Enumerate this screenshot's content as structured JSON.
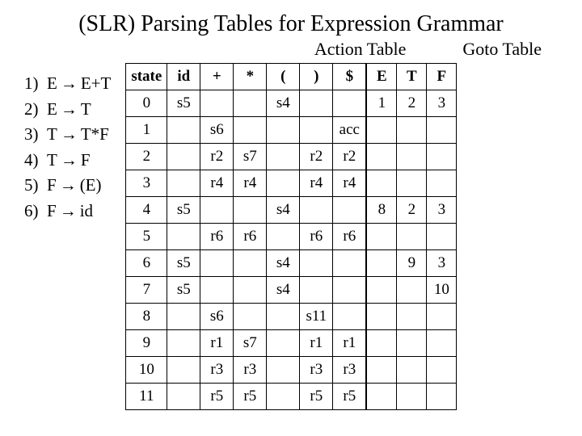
{
  "title": "(SLR) Parsing Tables for Expression Grammar",
  "action_title": "Action Table",
  "goto_title": "Goto Table",
  "grammar": [
    {
      "n": "1)",
      "lhs": "E",
      "rhs": "E+T"
    },
    {
      "n": "2)",
      "lhs": "E",
      "rhs": "T"
    },
    {
      "n": "3)",
      "lhs": "T",
      "rhs": "T*F"
    },
    {
      "n": "4)",
      "lhs": "T",
      "rhs": "F"
    },
    {
      "n": "5)",
      "lhs": "F",
      "rhs": "(E)"
    },
    {
      "n": "6)",
      "lhs": "F",
      "rhs": "id"
    }
  ],
  "arrow": "→",
  "headers": {
    "state": "state",
    "action": [
      "id",
      "+",
      "*",
      "(",
      ")",
      "$"
    ],
    "goto": [
      "E",
      "T",
      "F"
    ]
  },
  "chart_data": {
    "type": "table",
    "title": "SLR Parsing Table",
    "rows": [
      {
        "state": "0",
        "id": "s5",
        "plus": "",
        "star": "",
        "lpar": "s4",
        "rpar": "",
        "dollar": "",
        "E": "1",
        "T": "2",
        "F": "3"
      },
      {
        "state": "1",
        "id": "",
        "plus": "s6",
        "star": "",
        "lpar": "",
        "rpar": "",
        "dollar": "acc",
        "E": "",
        "T": "",
        "F": ""
      },
      {
        "state": "2",
        "id": "",
        "plus": "r2",
        "star": "s7",
        "lpar": "",
        "rpar": "r2",
        "dollar": "r2",
        "E": "",
        "T": "",
        "F": ""
      },
      {
        "state": "3",
        "id": "",
        "plus": "r4",
        "star": "r4",
        "lpar": "",
        "rpar": "r4",
        "dollar": "r4",
        "E": "",
        "T": "",
        "F": ""
      },
      {
        "state": "4",
        "id": "s5",
        "plus": "",
        "star": "",
        "lpar": "s4",
        "rpar": "",
        "dollar": "",
        "E": "8",
        "T": "2",
        "F": "3"
      },
      {
        "state": "5",
        "id": "",
        "plus": "r6",
        "star": "r6",
        "lpar": "",
        "rpar": "r6",
        "dollar": "r6",
        "E": "",
        "T": "",
        "F": ""
      },
      {
        "state": "6",
        "id": "s5",
        "plus": "",
        "star": "",
        "lpar": "s4",
        "rpar": "",
        "dollar": "",
        "E": "",
        "T": "9",
        "F": "3"
      },
      {
        "state": "7",
        "id": "s5",
        "plus": "",
        "star": "",
        "lpar": "s4",
        "rpar": "",
        "dollar": "",
        "E": "",
        "T": "",
        "F": "10"
      },
      {
        "state": "8",
        "id": "",
        "plus": "s6",
        "star": "",
        "lpar": "",
        "rpar": "s11",
        "dollar": "",
        "E": "",
        "T": "",
        "F": ""
      },
      {
        "state": "9",
        "id": "",
        "plus": "r1",
        "star": "s7",
        "lpar": "",
        "rpar": "r1",
        "dollar": "r1",
        "E": "",
        "T": "",
        "F": ""
      },
      {
        "state": "10",
        "id": "",
        "plus": "r3",
        "star": "r3",
        "lpar": "",
        "rpar": "r3",
        "dollar": "r3",
        "E": "",
        "T": "",
        "F": ""
      },
      {
        "state": "11",
        "id": "",
        "plus": "r5",
        "star": "r5",
        "lpar": "",
        "rpar": "r5",
        "dollar": "r5",
        "E": "",
        "T": "",
        "F": ""
      }
    ]
  }
}
